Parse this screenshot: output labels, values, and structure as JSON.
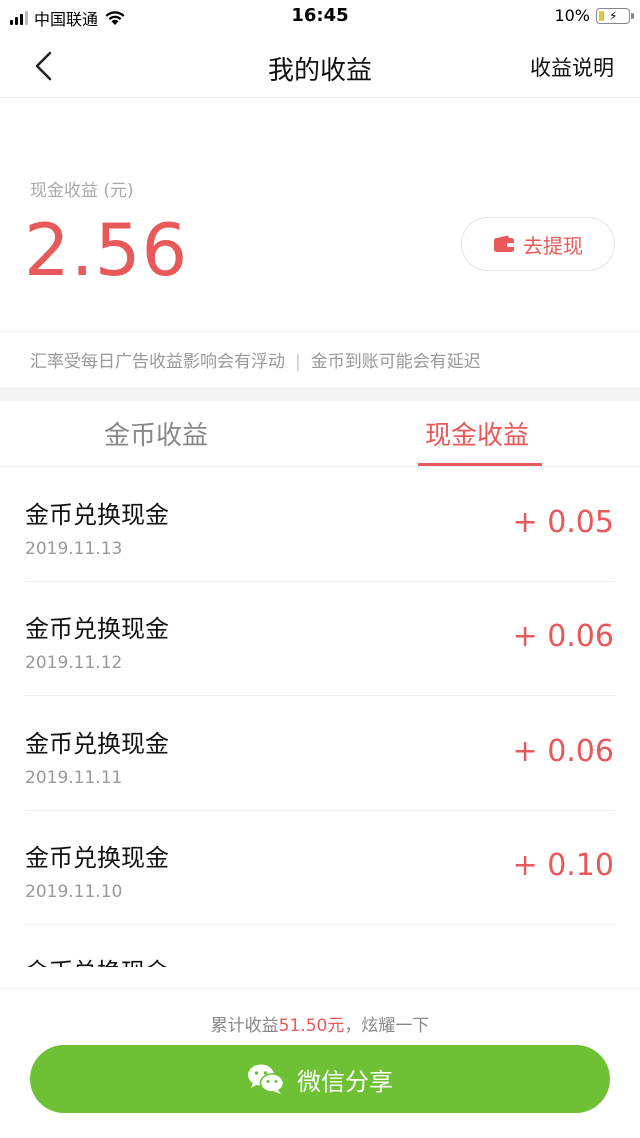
{
  "status_bar": {
    "carrier": "中国联通",
    "time": "16:45",
    "battery_percent": "10%",
    "battery_level": 0.1
  },
  "nav": {
    "title": "我的收益",
    "help": "收益说明"
  },
  "earnings": {
    "label": "现金收益 (元)",
    "amount": "2.56",
    "withdraw_label": "去提现"
  },
  "notice": {
    "left": "汇率受每日广告收益影响会有浮动",
    "separator": "|",
    "right": "金币到账可能会有延迟"
  },
  "tabs": [
    {
      "label": "金币收益",
      "active": false
    },
    {
      "label": "现金收益",
      "active": true
    }
  ],
  "records": [
    {
      "title": "金币兑换现金",
      "date": "2019.11.13",
      "amount": "+ 0.05"
    },
    {
      "title": "金币兑换现金",
      "date": "2019.11.12",
      "amount": "+ 0.06"
    },
    {
      "title": "金币兑换现金",
      "date": "2019.11.11",
      "amount": "+ 0.06"
    },
    {
      "title": "金币兑换现金",
      "date": "2019.11.10",
      "amount": "+ 0.10"
    },
    {
      "title": "金币兑换现金",
      "date": "",
      "amount": ""
    }
  ],
  "footer": {
    "summary_prefix": "累计收益",
    "summary_amount": "51.50元",
    "summary_suffix": "，炫耀一下",
    "share_label": "微信分享"
  },
  "colors": {
    "accent": "#e9595a",
    "share_green": "#6ec135",
    "muted_text": "#999999"
  },
  "icons": {
    "back": "chevron-left-icon",
    "wallet": "wallet-icon",
    "share": "wechat-icon",
    "wifi": "wifi-icon",
    "signal": "signal-icon",
    "battery": "battery-charging-icon"
  }
}
